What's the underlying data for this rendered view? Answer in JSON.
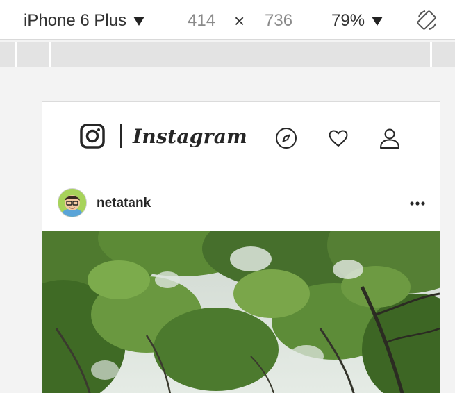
{
  "toolbar": {
    "device": "iPhone 6 Plus",
    "width": "414",
    "times": "×",
    "height": "736",
    "zoom": "79%",
    "rotate_icon": "rotate-device-icon"
  },
  "instagram": {
    "brand": "Instagram",
    "icons": [
      "instagram-camera-icon",
      "compass-explore-icon",
      "heart-icon",
      "profile-user-icon"
    ]
  },
  "post": {
    "username": "netatank",
    "more_icon": "more-options-icon",
    "image": "forest-canopy-photo"
  },
  "colors": {
    "toolbar_bg": "#ffffff",
    "ruler_bg": "#e3e3e3",
    "page_bg": "#f3f3f3",
    "ig_text": "#262626",
    "border": "#dbdbdb"
  }
}
